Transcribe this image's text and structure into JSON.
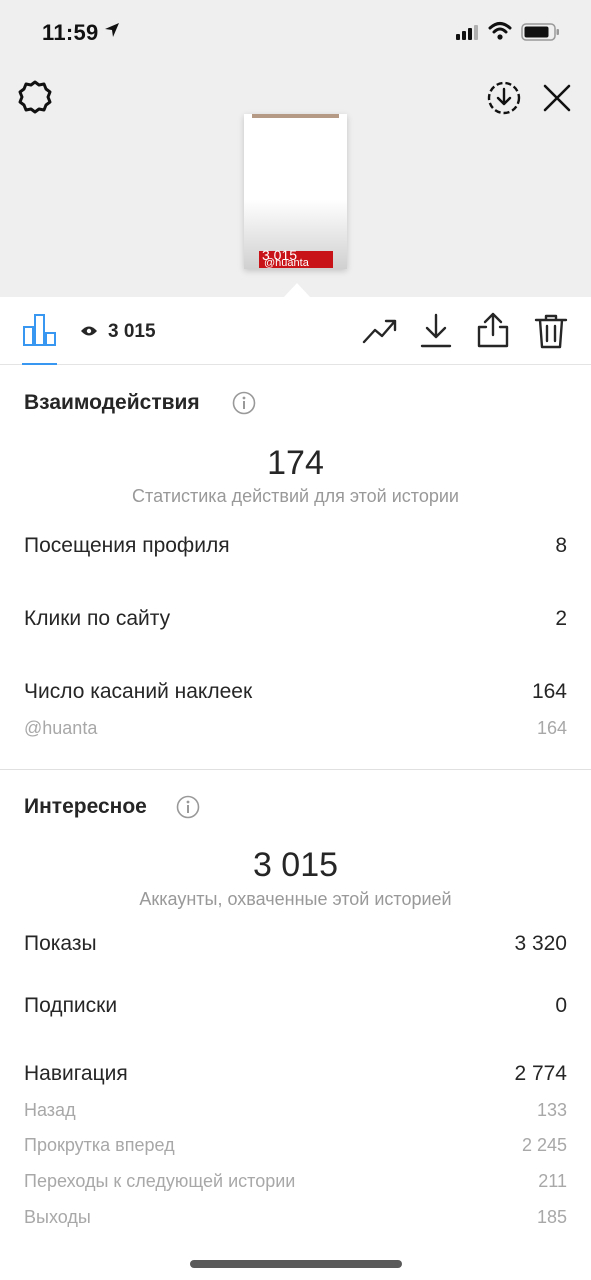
{
  "status_bar": {
    "time": "11:59"
  },
  "story_preview": {
    "views_overlay": "3 015",
    "handle_overlay": "@huanta"
  },
  "toolbar": {
    "view_count": "3 015"
  },
  "interactions": {
    "title": "Взаимодействия",
    "total": "174",
    "total_caption": "Статистика действий для этой истории",
    "rows": [
      {
        "label": "Посещения профиля",
        "value": "8"
      },
      {
        "label": "Клики по сайту",
        "value": "2"
      },
      {
        "label": "Число касаний наклеек",
        "value": "164"
      }
    ],
    "sticker_sub": {
      "label": "@huanta",
      "value": "164"
    }
  },
  "discovery": {
    "title": "Интересное",
    "total": "3 015",
    "total_caption": "Аккаунты, охваченные этой историей",
    "rows": [
      {
        "label": "Показы",
        "value": "3 320"
      },
      {
        "label": "Подписки",
        "value": "0"
      },
      {
        "label": "Навигация",
        "value": "2 774"
      }
    ],
    "navigation_sub": [
      {
        "label": "Назад",
        "value": "133"
      },
      {
        "label": "Прокрутка вперед",
        "value": "2 245"
      },
      {
        "label": "Переходы к следующей истории",
        "value": "211"
      },
      {
        "label": "Выходы",
        "value": "185"
      }
    ]
  },
  "colors": {
    "accent": "#3897f0",
    "sticker_red": "#c81418",
    "header_bg": "#efefef"
  },
  "icons": [
    "location-arrow-icon",
    "signal-icon",
    "wifi-icon",
    "battery-icon",
    "settings-icon",
    "download-circle-icon",
    "close-icon",
    "bar-chart-icon",
    "eye-icon",
    "trend-icon",
    "download-icon",
    "share-icon",
    "trash-icon",
    "info-icon"
  ]
}
